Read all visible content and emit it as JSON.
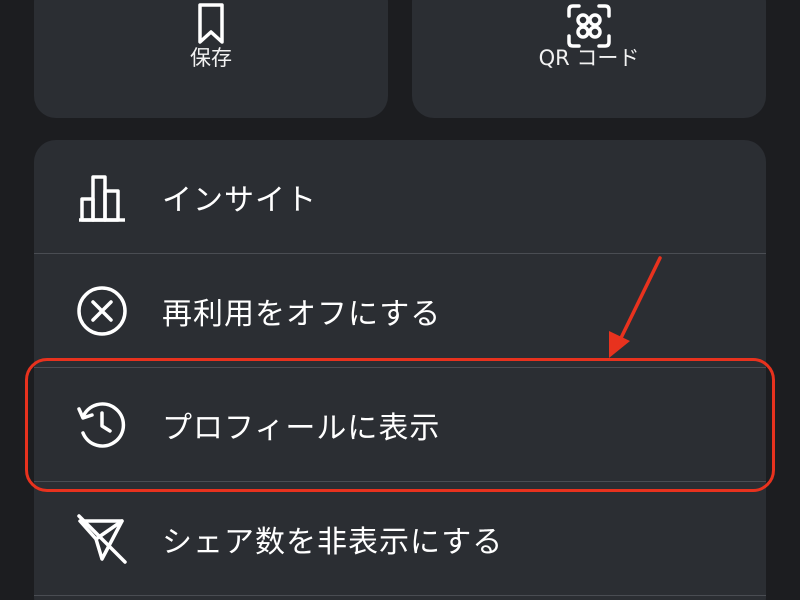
{
  "cards": {
    "save": {
      "label": "保存",
      "icon": "bookmark-icon"
    },
    "qr": {
      "label": "QR コード",
      "icon": "qr-code-icon"
    }
  },
  "menu": {
    "items": [
      {
        "label": "インサイト",
        "icon": "bar-chart-icon"
      },
      {
        "label": "再利用をオフにする",
        "icon": "circle-x-icon"
      },
      {
        "label": "プロフィールに表示",
        "icon": "history-icon"
      },
      {
        "label": "シェア数を非表示にする",
        "icon": "share-off-icon"
      }
    ]
  },
  "annotation": {
    "color": "#e8321e",
    "target": "プロフィールに表示"
  },
  "colors": {
    "background": "#1c1d20",
    "surface": "#2b2e33",
    "divider": "#4a4d53",
    "text": "#ffffff",
    "annotation": "#e8321e"
  }
}
